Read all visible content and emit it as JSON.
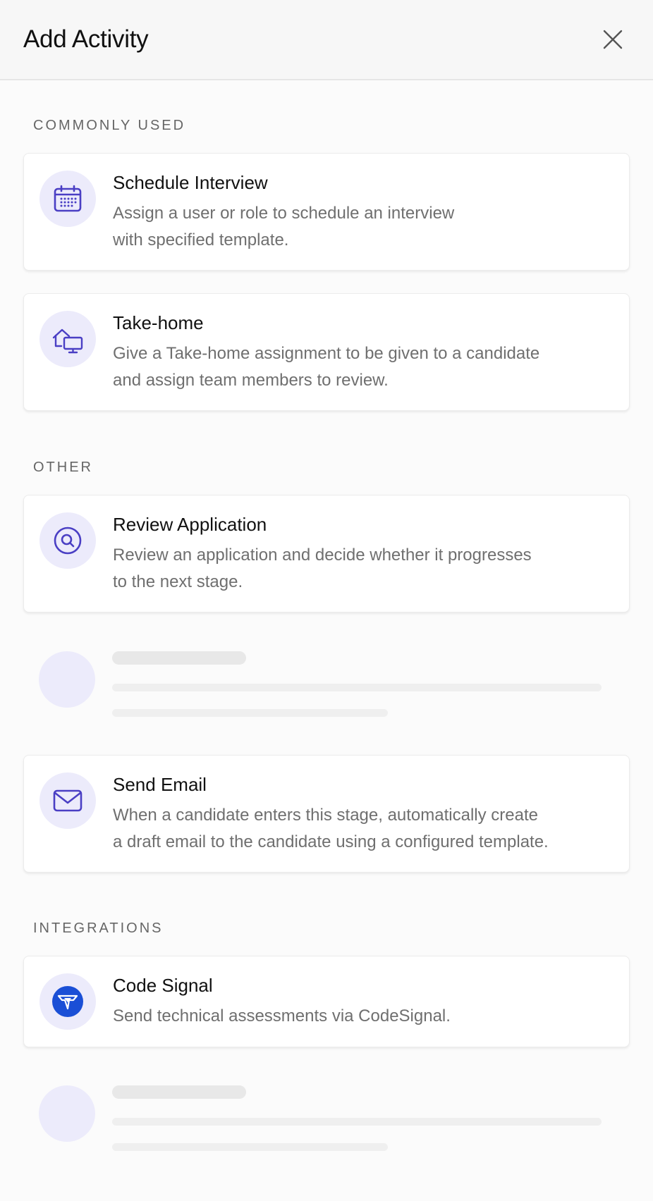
{
  "header": {
    "title": "Add Activity",
    "close_icon": "close-icon"
  },
  "sections": {
    "commonly_used": "COMMONLY USED",
    "other": "OTHER",
    "integrations": "INTEGRATIONS"
  },
  "activities": {
    "schedule_interview": {
      "icon": "calendar-icon",
      "title": "Schedule Interview",
      "description": "Assign a user or role to schedule an interview\nwith specified template."
    },
    "take_home": {
      "icon": "home-monitor-icon",
      "title": "Take-home",
      "description": "Give a Take-home assignment to be given to a candidate\nand assign team members to review."
    },
    "review_application": {
      "icon": "search-icon",
      "title": "Review Application",
      "description": "Review an application and decide whether it progresses\nto the next stage."
    },
    "send_email": {
      "icon": "mail-icon",
      "title": "Send Email",
      "description": "When a candidate enters this stage, automatically create\na draft email to the candidate using a configured template."
    },
    "code_signal": {
      "icon": "codesignal-logo-icon",
      "title": "Code Signal",
      "description": "Send technical assessments via CodeSignal."
    }
  },
  "colors": {
    "accent": "#4a3fc4",
    "icon_bg": "#ecebfb",
    "codesignal_blue": "#1a4fd6"
  }
}
